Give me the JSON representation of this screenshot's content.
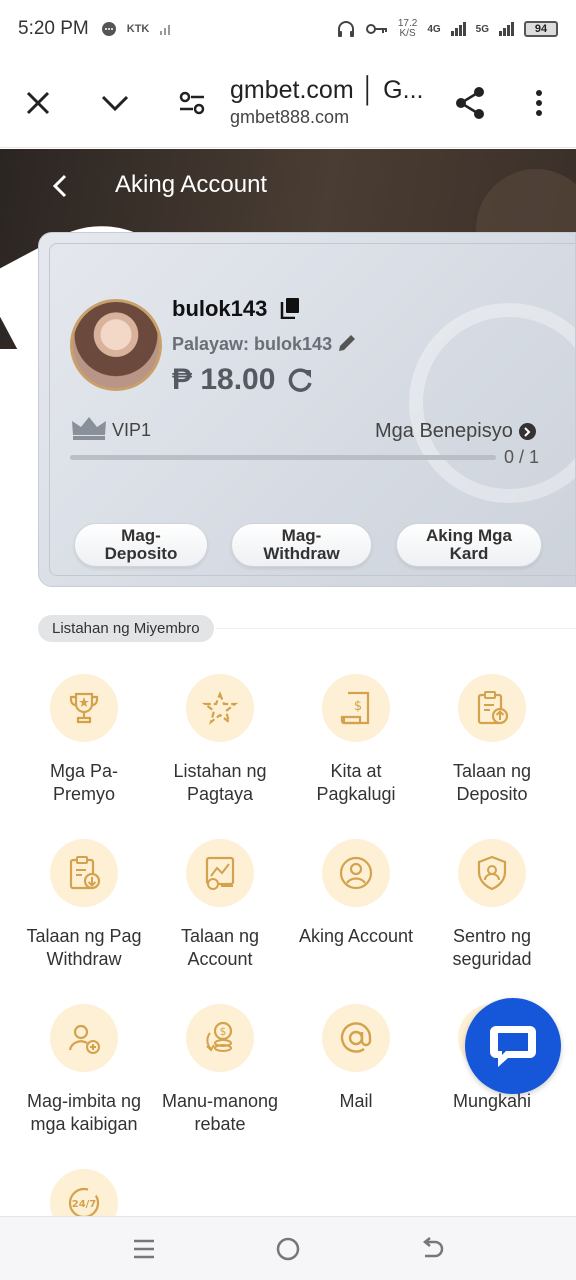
{
  "status_bar": {
    "time": "5:20 PM",
    "carrier": "KTK",
    "net_speed_value": "17.2",
    "net_speed_unit": "K/S",
    "net1": "4G",
    "net2": "5G",
    "battery": "94"
  },
  "browser": {
    "title": "gmbet.com │ G...",
    "url": "gmbet888.com"
  },
  "header": {
    "title": "Aking Account"
  },
  "profile": {
    "username": "bulok143",
    "nickname": "Palayaw: bulok143",
    "balance": "₱ 18.00",
    "vip_level": "VIP1",
    "benefits_label": "Mga Benepisyo",
    "vip_progress": 0,
    "vip_progress_text": "0 / 1",
    "buttons": {
      "deposit": "Mag-\nDeposito",
      "withdraw": "Mag-\nWithdraw",
      "cards": "Aking Mga\nKard"
    }
  },
  "section": {
    "label": "Listahan ng Miyembro"
  },
  "menu": [
    {
      "label": "Mga Pa-\nPremyo",
      "icon": "trophy-icon"
    },
    {
      "label": "Listahan ng\nPagtaya",
      "icon": "star-sparkle-icon"
    },
    {
      "label": "Kita at\nPagkalugi",
      "icon": "receipt-dollar-icon"
    },
    {
      "label": "Talaan ng\nDeposito",
      "icon": "clipboard-upload-icon"
    },
    {
      "label": "Talaan ng Pag\nWithdraw",
      "icon": "clipboard-download-icon"
    },
    {
      "label": "Talaan ng\nAccount",
      "icon": "account-ledger-icon"
    },
    {
      "label": "Aking Account",
      "icon": "user-circle-icon"
    },
    {
      "label": "Sentro ng\nseguridad",
      "icon": "shield-user-icon"
    },
    {
      "label": "Mag-imbita ng\nmga kaibigan",
      "icon": "invite-user-icon"
    },
    {
      "label": "Manu-manong\nrebate",
      "icon": "coins-rebate-icon"
    },
    {
      "label": "Mail",
      "icon": "at-sign-icon"
    },
    {
      "label": "Mungkahi",
      "icon": "suggestion-icon"
    },
    {
      "label": "",
      "icon": "support-24-7-icon"
    }
  ],
  "colors": {
    "accent_blue": "#1657d9",
    "icon_bg": "#fdf0d5",
    "icon_gold": "#d4a24c",
    "header_dark": "#2b2522"
  }
}
